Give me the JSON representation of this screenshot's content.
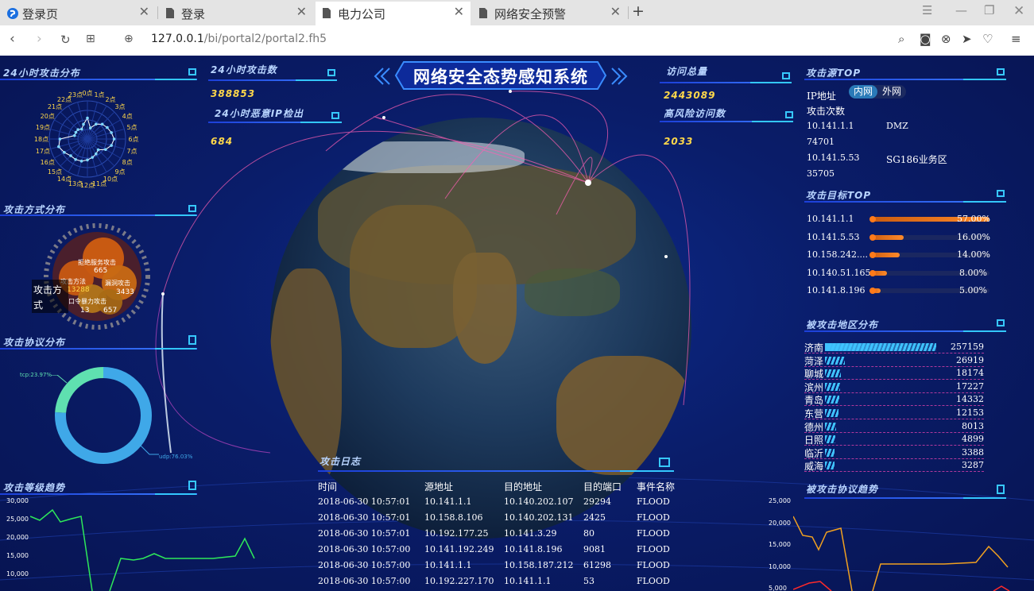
{
  "browser": {
    "tabs": [
      {
        "label": "登录页"
      },
      {
        "label": "登录"
      },
      {
        "label": "电力公司"
      },
      {
        "label": "网络安全预警"
      }
    ],
    "url_host": "127.0.0.1",
    "url_path": "/bi/portal2/portal2.fh5"
  },
  "dashboard": {
    "title": "网络安全态势感知系统",
    "attack_24h_dist": {
      "title": "24小时攻击分布",
      "hours": [
        "0点",
        "1点",
        "2点",
        "3点",
        "4点",
        "5点",
        "6点",
        "7点",
        "8点",
        "9点",
        "10点",
        "11点",
        "12点",
        "13点",
        "14点",
        "15点",
        "16点",
        "17点",
        "18点",
        "19点",
        "20点",
        "21点",
        "22点",
        "23点"
      ]
    },
    "attack_24h_count": {
      "title": "24小时攻击数",
      "value": "388853"
    },
    "malicious_ip_24h": {
      "title": "24小时恶意IP检出",
      "value": "684"
    },
    "total_visits": {
      "title": "访问总量",
      "value": "2443089"
    },
    "high_risk_visits": {
      "title": "高风险访问数",
      "value": "2033"
    },
    "attack_method": {
      "title": "攻击方式分布",
      "center_label": "攻击方式",
      "bubbles": [
        {
          "label": "拒绝服务攻击",
          "value": "665"
        },
        {
          "label": "攻击方法",
          "value": "13288"
        },
        {
          "label": "漏洞攻击",
          "value": "3433"
        },
        {
          "label": "口令暴力攻击",
          "value": "13"
        },
        {
          "label": "",
          "value": "657"
        }
      ]
    },
    "protocol_dist": {
      "title": "攻击协议分布",
      "tcp_label": "tcp:23.97%",
      "udp_label": "udp:76.03%",
      "tcp_pct": 23.97,
      "udp_pct": 76.03
    },
    "attack_level_trend": {
      "title": "攻击等级趋势",
      "yticks": [
        "30,000",
        "25,000",
        "20,000",
        "15,000",
        "10,000"
      ]
    },
    "attack_source_top": {
      "title": "攻击源TOP",
      "toggle_inner": "内网",
      "toggle_outer": "外网",
      "col_ip": "IP地址",
      "col_count": "攻击次数",
      "rows": [
        {
          "ip": "10.141.1.1",
          "zone": "DMZ",
          "count": "74701"
        },
        {
          "ip": "10.141.5.53",
          "zone": "SG186业务区",
          "count": "35705"
        }
      ]
    },
    "attack_target_top": {
      "title": "攻击目标TOP",
      "rows": [
        {
          "ip": "10.141.1.1",
          "pct_label": "57.00%",
          "pct": 57
        },
        {
          "ip": "10.141.5.53",
          "pct_label": "16.00%",
          "pct": 16
        },
        {
          "ip": "10.158.242....",
          "pct_label": "14.00%",
          "pct": 14
        },
        {
          "ip": "10.140.51.165",
          "pct_label": "8.00%",
          "pct": 8
        },
        {
          "ip": "10.141.8.196",
          "pct_label": "5.00%",
          "pct": 5
        }
      ]
    },
    "attacked_regions": {
      "title": "被攻击地区分布",
      "rows": [
        {
          "name": "济南",
          "value": 257159
        },
        {
          "name": "菏泽",
          "value": 26919
        },
        {
          "name": "聊城",
          "value": 18174
        },
        {
          "name": "滨州",
          "value": 17227
        },
        {
          "name": "青岛",
          "value": 14332
        },
        {
          "name": "东营",
          "value": 12153
        },
        {
          "name": "德州",
          "value": 8013
        },
        {
          "name": "日照",
          "value": 4899
        },
        {
          "name": "临沂",
          "value": 3388
        },
        {
          "name": "威海",
          "value": 3287
        }
      ]
    },
    "attacked_protocol_trend": {
      "title": "被攻击协议趋势",
      "yticks": [
        "25,000",
        "20,000",
        "15,000",
        "10,000",
        "5,000"
      ]
    },
    "attack_log": {
      "title": "攻击日志",
      "headers": [
        "时间",
        "源地址",
        "目的地址",
        "目的端口",
        "事件名称"
      ],
      "rows": [
        [
          "2018-06-30 10:57:01",
          "10.141.1.1",
          "10.140.202.107",
          "29294",
          "FLOOD"
        ],
        [
          "2018-06-30 10:57:01",
          "10.158.8.106",
          "10.140.202.131",
          "2425",
          "FLOOD"
        ],
        [
          "2018-06-30 10:57:01",
          "10.192.177.25",
          "10.141.3.29",
          "80",
          "FLOOD"
        ],
        [
          "2018-06-30 10:57:00",
          "10.141.192.249",
          "10.141.8.196",
          "9081",
          "FLOOD"
        ],
        [
          "2018-06-30 10:57:00",
          "10.141.1.1",
          "10.158.187.212",
          "61298",
          "FLOOD"
        ],
        [
          "2018-06-30 10:57:00",
          "10.192.227.170",
          "10.141.1.1",
          "53",
          "FLOOD"
        ]
      ]
    }
  },
  "colors": {
    "accent": "#33c7ff",
    "number": "#ffd84a",
    "bar": "#ff7a1a",
    "bg": "#0b1a5a"
  }
}
